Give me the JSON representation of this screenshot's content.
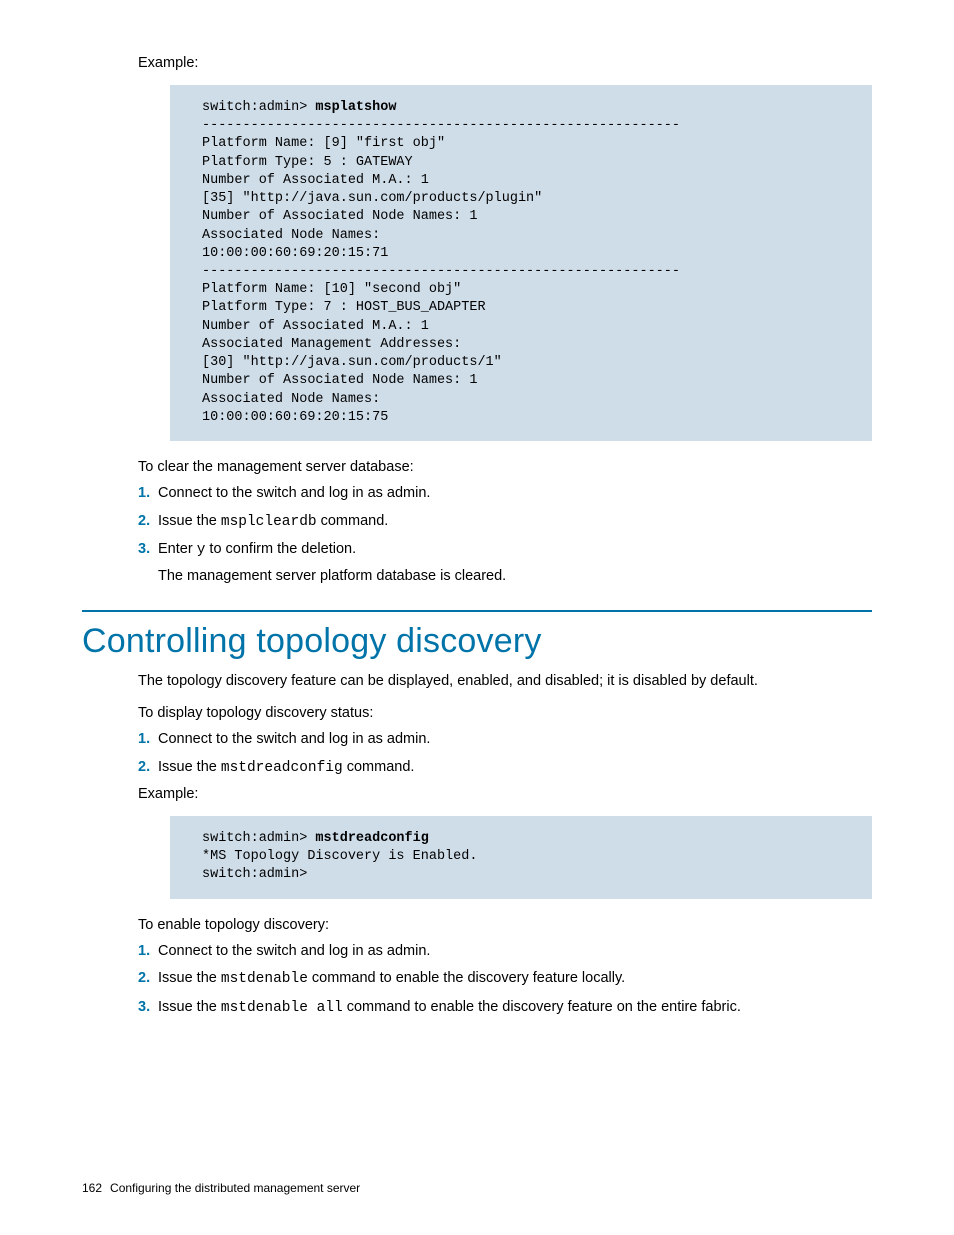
{
  "top": {
    "example_label": "Example:",
    "code_prompt": "switch:admin> ",
    "code_cmd": "msplatshow",
    "code_body": "-----------------------------------------------------------\nPlatform Name: [9] \"first obj\"\nPlatform Type: 5 : GATEWAY\nNumber of Associated M.A.: 1\n[35] \"http://java.sun.com/products/plugin\"\nNumber of Associated Node Names: 1\nAssociated Node Names:\n10:00:00:60:69:20:15:71\n-----------------------------------------------------------\nPlatform Name: [10] \"second obj\"\nPlatform Type: 7 : HOST_BUS_ADAPTER\nNumber of Associated M.A.: 1\nAssociated Management Addresses:\n[30] \"http://java.sun.com/products/1\"\nNumber of Associated Node Names: 1\nAssociated Node Names:\n10:00:00:60:69:20:15:75",
    "clear_intro": "To clear the management server database:",
    "step1": "Connect to the switch and log in as admin.",
    "step2_a": "Issue the ",
    "step2_cmd": "msplcleardb",
    "step2_b": " command.",
    "step3_a": "Enter ",
    "step3_cmd": "y",
    "step3_b": " to confirm the deletion.",
    "step3_sub": "The management server platform database is cleared."
  },
  "section": {
    "title": "Controlling topology discovery",
    "intro": "The topology discovery feature can be displayed, enabled, and disabled; it is disabled by default.",
    "display_intro": "To display topology discovery status:",
    "d_step1": "Connect to the switch and log in as admin.",
    "d_step2_a": "Issue the ",
    "d_step2_cmd": "mstdreadconfig",
    "d_step2_b": " command.",
    "example_label": "Example:",
    "code_prompt": "switch:admin> ",
    "code_cmd": "mstdreadconfig",
    "code_body": "*MS Topology Discovery is Enabled.\nswitch:admin>",
    "enable_intro": "To enable topology discovery:",
    "e_step1": "Connect to the switch and log in as admin.",
    "e_step2_a": "Issue the ",
    "e_step2_cmd": "mstdenable",
    "e_step2_b": " command to enable the discovery feature locally.",
    "e_step3_a": "Issue the ",
    "e_step3_cmd": "mstdenable all",
    "e_step3_b": " command to enable the discovery feature on the entire fabric."
  },
  "footer": {
    "page": "162",
    "chapter": "Configuring the distributed management server"
  }
}
